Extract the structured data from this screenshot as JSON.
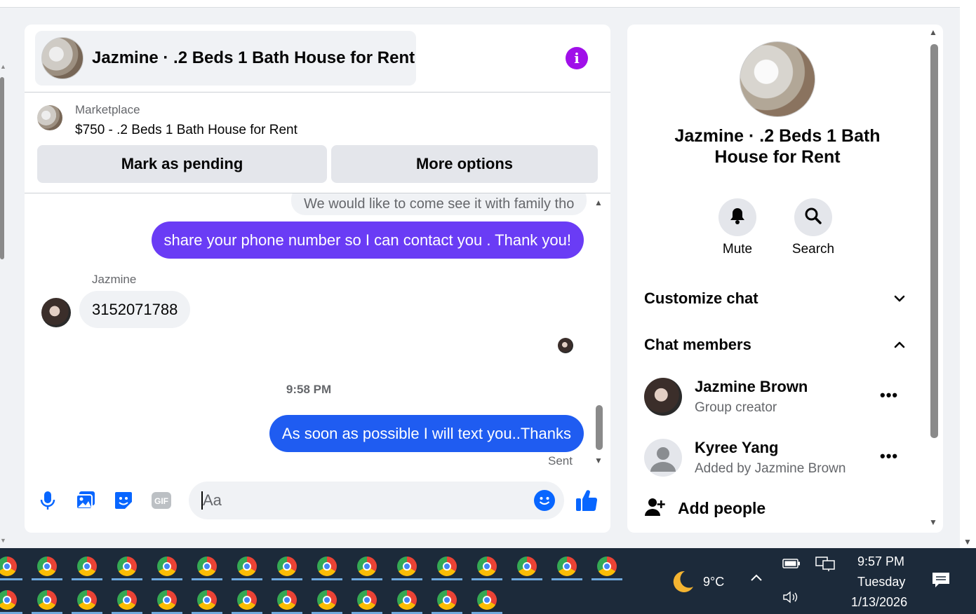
{
  "chat": {
    "header_title": "Jazmine · .2 Beds 1 Bath House for Rent",
    "listing": {
      "source_label": "Marketplace",
      "title": "$750 - .2 Beds 1 Bath House for Rent"
    },
    "buttons": {
      "mark_pending": "Mark as pending",
      "more_options": "More options"
    },
    "messages": [
      {
        "direction": "in",
        "text": "We would like to come see it with family tho"
      },
      {
        "direction": "out",
        "text": "share your phone number so I can contact you . Thank you!"
      },
      {
        "direction": "in",
        "sender": "Jazmine",
        "text": "3152071788"
      },
      {
        "direction": "out",
        "text": "As soon as possible I will text you..Thanks"
      }
    ],
    "timestamp": "9:58 PM",
    "status": "Sent",
    "composer": {
      "placeholder": "Aa"
    },
    "composer_icons": [
      "microphone-icon",
      "photo-icon",
      "sticker-icon",
      "gif-icon",
      "emoji-icon",
      "thumbs-up-icon"
    ],
    "colors": {
      "accent": "#0866ff",
      "bubble_purple": "#6a3cf5",
      "bubble_blue": "#1f5cf1",
      "info": "#a00fe9"
    }
  },
  "side_panel": {
    "title": "Jazmine · .2 Beds 1 Bath House for Rent",
    "actions": [
      {
        "label": "Mute",
        "icon": "bell-icon"
      },
      {
        "label": "Search",
        "icon": "search-icon"
      }
    ],
    "sections": {
      "customize": "Customize chat",
      "members": "Chat members"
    },
    "members": [
      {
        "name": "Jazmine Brown",
        "role": "Group creator"
      },
      {
        "name": "Kyree Yang",
        "role": "Added by Jazmine Brown"
      }
    ],
    "add_people": "Add people"
  },
  "taskbar": {
    "weather": "9°C",
    "time": "9:57 PM",
    "day": "Tuesday",
    "date": "1/13/2026",
    "app_icon": "chrome-icon"
  }
}
